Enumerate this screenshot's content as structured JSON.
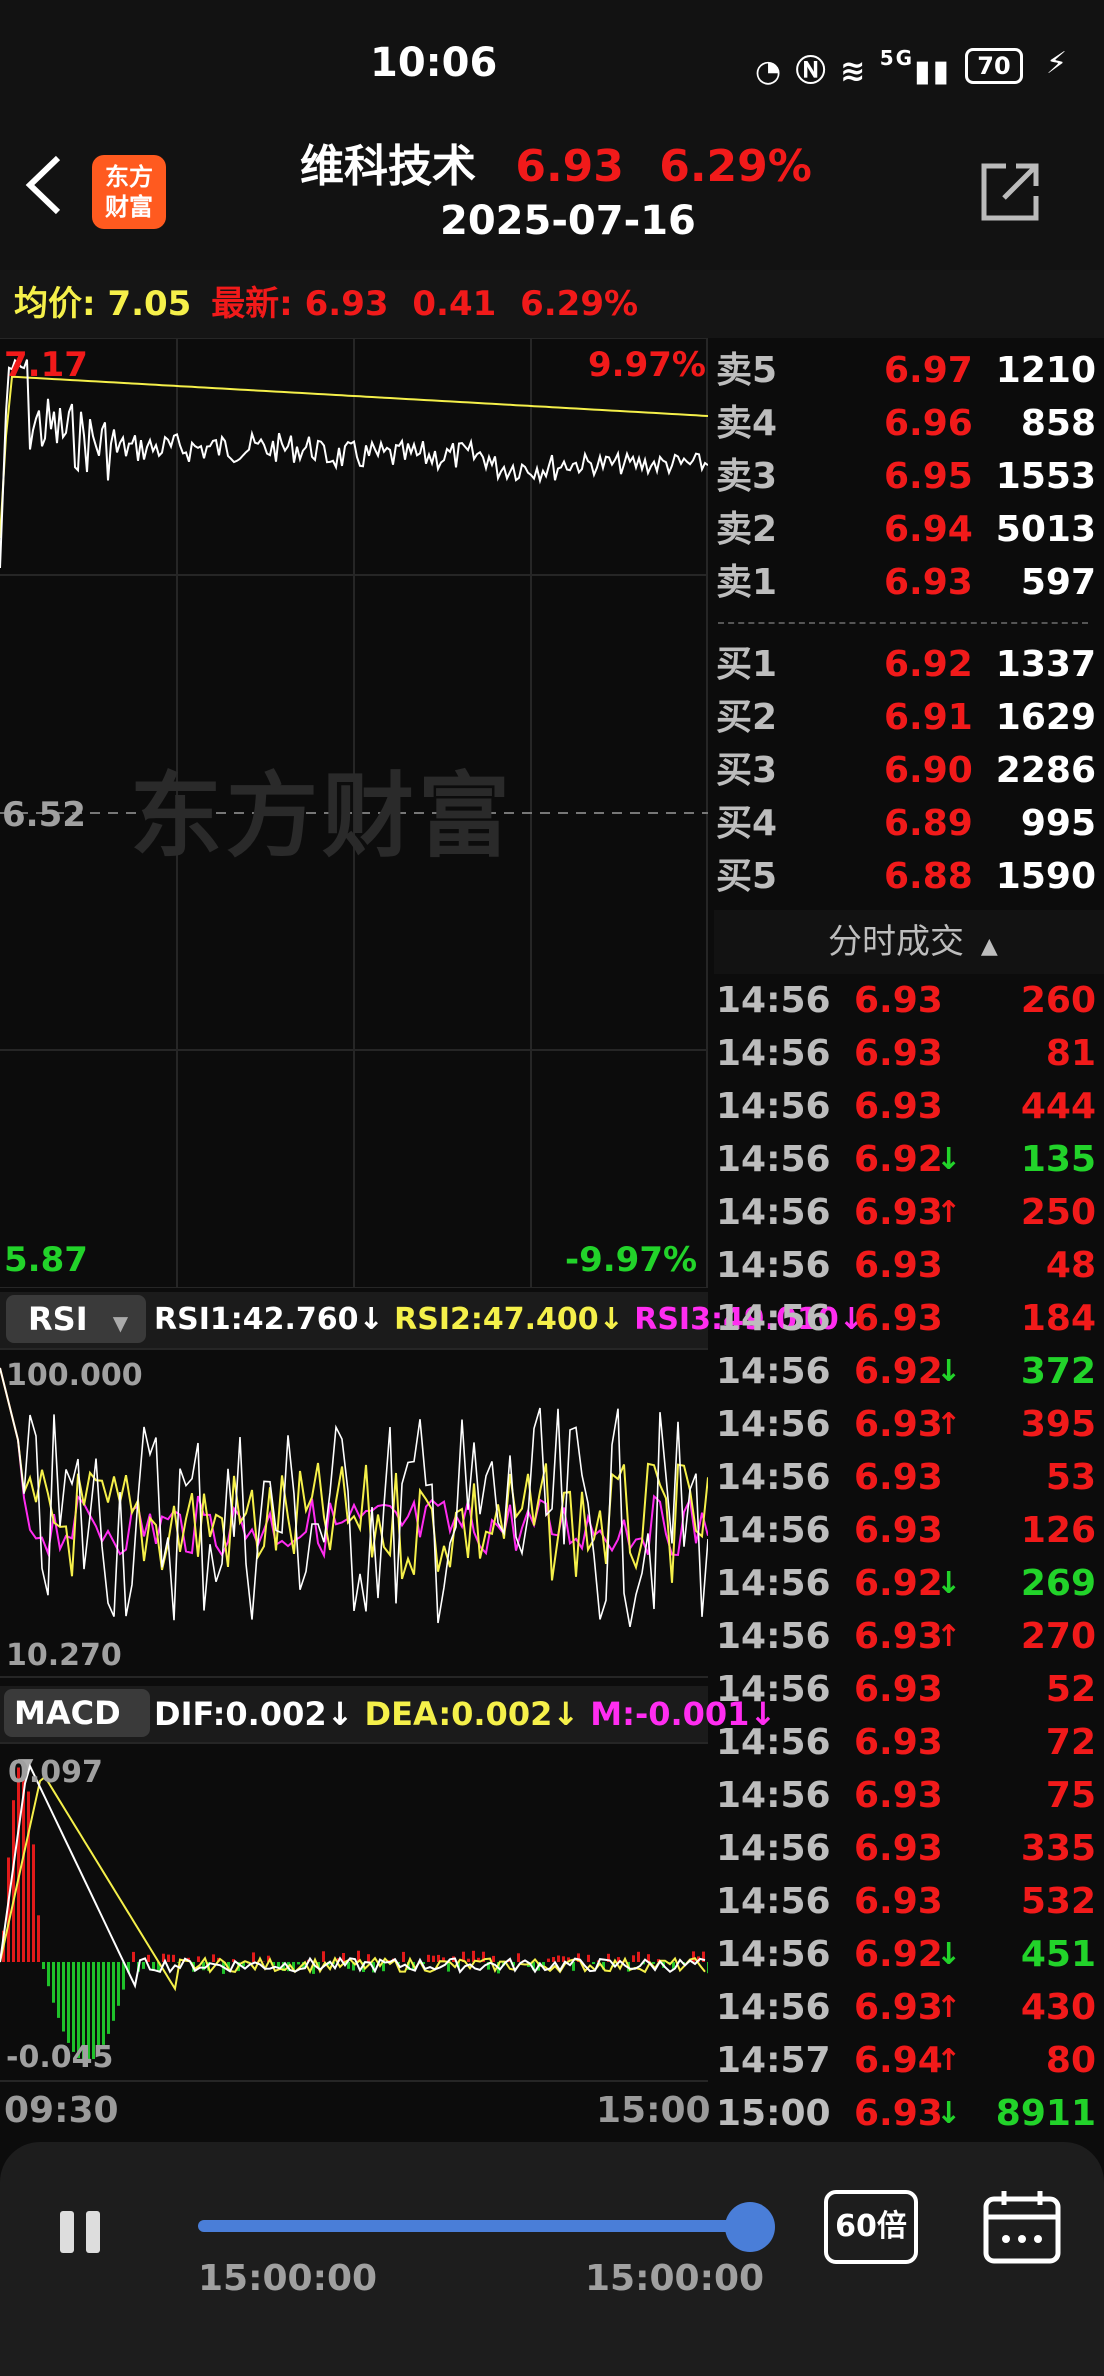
{
  "status_bar": {
    "time": "10:06",
    "icons": [
      "speedometer-icon",
      "nfc-icon",
      "wifi-icon",
      "signal-5g-icon",
      "charging-icon"
    ],
    "network": "5G",
    "battery": "70"
  },
  "header": {
    "back_icon": "chevron-left-icon",
    "logo_line1": "东方",
    "logo_line2": "财富",
    "stock_name": "维科技术",
    "price": "6.93",
    "change_pct": "6.29%",
    "date": "2025-07-16",
    "share_icon": "external-link-icon"
  },
  "info_bar": {
    "avg_label": "均价:",
    "avg_value": "7.05",
    "latest_label": "最新:",
    "latest_price": "6.93",
    "latest_change": "0.41",
    "latest_pct": "6.29%"
  },
  "main_chart": {
    "high_price": "7.17",
    "high_pct": "9.97%",
    "mid_price": "6.52",
    "low_price": "5.87",
    "low_pct": "-9.97%",
    "watermark": "东方财富",
    "colors": {
      "price_line": "#ffffff",
      "avg_line": "#f5f04a"
    }
  },
  "rsi": {
    "selector": "RSI",
    "rsi1": "RSI1:42.760↓",
    "rsi2": "RSI2:47.400↓",
    "rsi3": "RSI3:49.010↓",
    "top": "100.000",
    "bottom": "10.270"
  },
  "macd": {
    "selector": "MACD",
    "dif": "DIF:0.002↓",
    "dea": "DEA:0.002↓",
    "m": "M:-0.001↓",
    "top": "0.097",
    "bottom": "-0.045"
  },
  "time_axis": {
    "start": "09:30",
    "end": "15:00"
  },
  "orderbook": {
    "asks": [
      {
        "label": "卖5",
        "price": "6.97",
        "volume": "1210"
      },
      {
        "label": "卖4",
        "price": "6.96",
        "volume": "858"
      },
      {
        "label": "卖3",
        "price": "6.95",
        "volume": "1553"
      },
      {
        "label": "卖2",
        "price": "6.94",
        "volume": "5013"
      },
      {
        "label": "卖1",
        "price": "6.93",
        "volume": "597"
      }
    ],
    "bids": [
      {
        "label": "买1",
        "price": "6.92",
        "volume": "1337"
      },
      {
        "label": "买2",
        "price": "6.91",
        "volume": "1629"
      },
      {
        "label": "买3",
        "price": "6.90",
        "volume": "2286"
      },
      {
        "label": "买4",
        "price": "6.89",
        "volume": "995"
      },
      {
        "label": "买5",
        "price": "6.88",
        "volume": "1590"
      }
    ]
  },
  "trades": {
    "title": "分时成交",
    "rows": [
      {
        "time": "14:56",
        "price": "6.93",
        "arrow": "",
        "volume": "260",
        "dir": "buy"
      },
      {
        "time": "14:56",
        "price": "6.93",
        "arrow": "",
        "volume": "81",
        "dir": "buy"
      },
      {
        "time": "14:56",
        "price": "6.93",
        "arrow": "",
        "volume": "444",
        "dir": "buy"
      },
      {
        "time": "14:56",
        "price": "6.92",
        "arrow": "↓",
        "volume": "135",
        "dir": "sell"
      },
      {
        "time": "14:56",
        "price": "6.93",
        "arrow": "↑",
        "volume": "250",
        "dir": "buy"
      },
      {
        "time": "14:56",
        "price": "6.93",
        "arrow": "",
        "volume": "48",
        "dir": "buy"
      },
      {
        "time": "14:56",
        "price": "6.93",
        "arrow": "",
        "volume": "184",
        "dir": "buy"
      },
      {
        "time": "14:56",
        "price": "6.92",
        "arrow": "↓",
        "volume": "372",
        "dir": "sell"
      },
      {
        "time": "14:56",
        "price": "6.93",
        "arrow": "↑",
        "volume": "395",
        "dir": "buy"
      },
      {
        "time": "14:56",
        "price": "6.93",
        "arrow": "",
        "volume": "53",
        "dir": "buy"
      },
      {
        "time": "14:56",
        "price": "6.93",
        "arrow": "",
        "volume": "126",
        "dir": "buy"
      },
      {
        "time": "14:56",
        "price": "6.92",
        "arrow": "↓",
        "volume": "269",
        "dir": "sell"
      },
      {
        "time": "14:56",
        "price": "6.93",
        "arrow": "↑",
        "volume": "270",
        "dir": "buy"
      },
      {
        "time": "14:56",
        "price": "6.93",
        "arrow": "",
        "volume": "52",
        "dir": "buy"
      },
      {
        "time": "14:56",
        "price": "6.93",
        "arrow": "",
        "volume": "72",
        "dir": "buy"
      },
      {
        "time": "14:56",
        "price": "6.93",
        "arrow": "",
        "volume": "75",
        "dir": "buy"
      },
      {
        "time": "14:56",
        "price": "6.93",
        "arrow": "",
        "volume": "335",
        "dir": "buy"
      },
      {
        "time": "14:56",
        "price": "6.93",
        "arrow": "",
        "volume": "532",
        "dir": "buy"
      },
      {
        "time": "14:56",
        "price": "6.92",
        "arrow": "↓",
        "volume": "451",
        "dir": "sell"
      },
      {
        "time": "14:56",
        "price": "6.93",
        "arrow": "↑",
        "volume": "430",
        "dir": "buy"
      },
      {
        "time": "14:57",
        "price": "6.94",
        "arrow": "↑",
        "volume": "80",
        "dir": "buy"
      },
      {
        "time": "15:00",
        "price": "6.93",
        "arrow": "↓",
        "volume": "8911",
        "dir": "sell"
      }
    ]
  },
  "player": {
    "pause_icon": "pause-icon",
    "progress": 1.0,
    "current_time": "15:00:00",
    "end_time": "15:00:00",
    "speed_label": "60倍",
    "calendar_icon": "calendar-icon",
    "accent": "#4a7ed8"
  }
}
